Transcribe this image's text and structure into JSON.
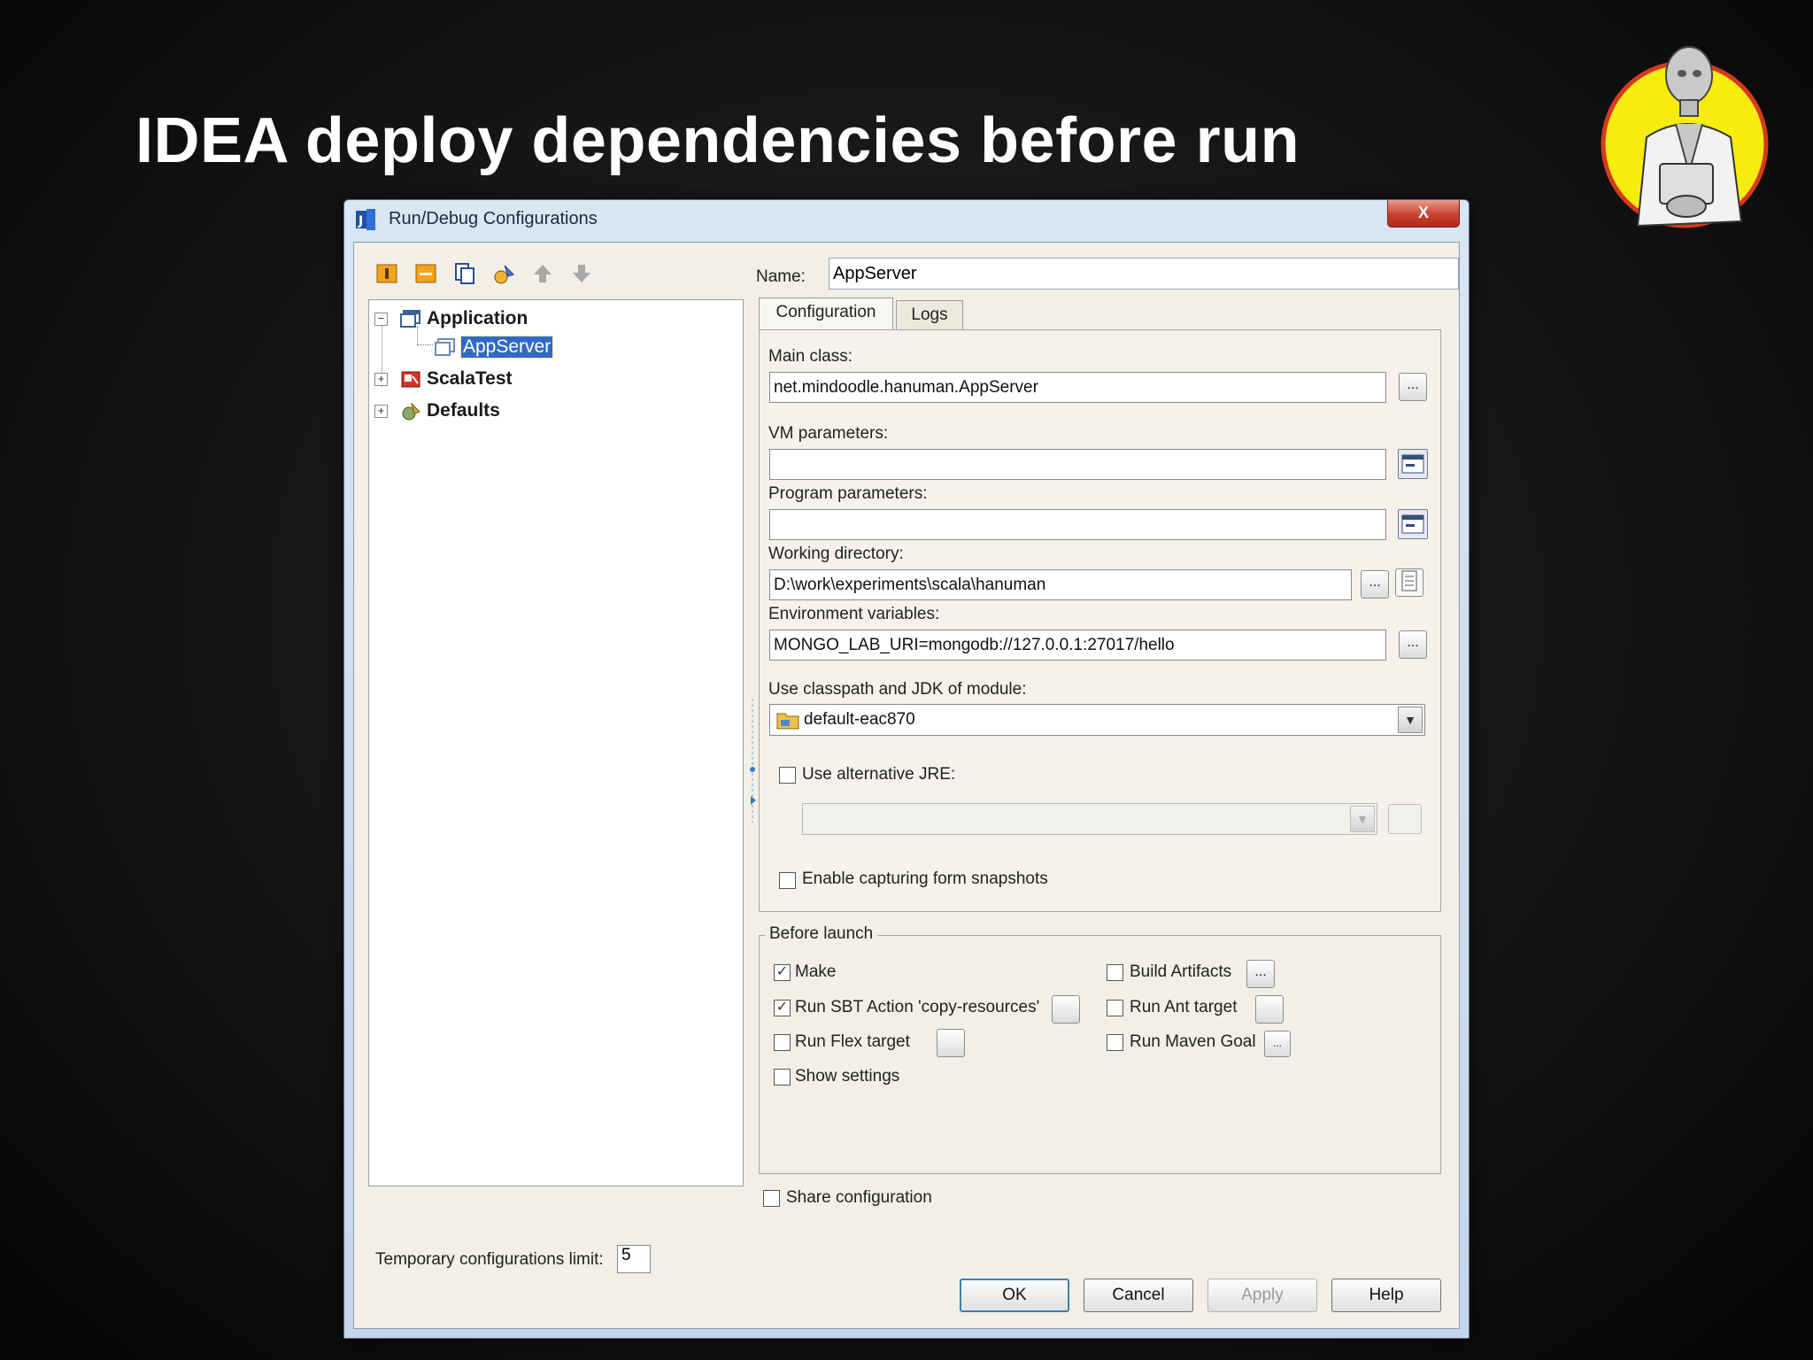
{
  "slide": {
    "title": "IDEA deploy dependencies before run"
  },
  "dialog": {
    "title": "Run/Debug Configurations",
    "close_label": "X",
    "toolbar_icons": [
      "add-icon",
      "remove-icon",
      "copy-icon",
      "edit-defaults-icon",
      "move-up-icon",
      "move-down-icon"
    ],
    "tree": {
      "items": [
        {
          "label": "Application",
          "expander": "−",
          "icon": "application-icon"
        },
        {
          "label": "AppServer",
          "icon": "app-config-icon",
          "selected": true
        },
        {
          "label": "ScalaTest",
          "expander": "+",
          "icon": "scalatest-icon"
        },
        {
          "label": "Defaults",
          "expander": "+",
          "icon": "defaults-icon"
        }
      ]
    },
    "temp_limit": {
      "label": "Temporary configurations limit:",
      "value": "5"
    },
    "name": {
      "label": "Name:",
      "value": "AppServer"
    },
    "tabs": [
      {
        "label": "Configuration",
        "active": true
      },
      {
        "label": "Logs",
        "active": false
      }
    ],
    "fields": {
      "main_class": {
        "label": "Main class:",
        "value": "net.mindoodle.hanuman.AppServer",
        "button": "..."
      },
      "vm_params": {
        "label": "VM parameters:",
        "value": ""
      },
      "program_params": {
        "label": "Program parameters:",
        "value": ""
      },
      "working_dir": {
        "label": "Working directory:",
        "value": "D:\\work\\experiments\\scala\\hanuman",
        "button": "..."
      },
      "env_vars": {
        "label": "Environment variables:",
        "value": "MONGO_LAB_URI=mongodb://127.0.0.1:27017/hello",
        "button": "..."
      },
      "classpath": {
        "label": "Use classpath and JDK of module:",
        "value": "default-eac870"
      },
      "alt_jre": {
        "label": "Use alternative JRE:",
        "checked": false,
        "value": ""
      },
      "snapshots": {
        "label": "Enable capturing form snapshots",
        "checked": false
      }
    },
    "before_launch": {
      "legend": "Before launch",
      "items": [
        {
          "label": "Make",
          "checked": true
        },
        {
          "label": "Run SBT Action 'copy-resources'",
          "checked": true
        },
        {
          "label": "Run Flex target",
          "checked": false
        },
        {
          "label": "Show settings",
          "checked": false
        },
        {
          "label": "Build Artifacts",
          "checked": false
        },
        {
          "label": "Run Ant target",
          "checked": false
        },
        {
          "label": "Run Maven Goal",
          "checked": false
        }
      ],
      "ellipsis": "...",
      "mini": "..."
    },
    "share": {
      "label": "Share configuration",
      "checked": false
    },
    "buttons": {
      "ok": "OK",
      "cancel": "Cancel",
      "apply": "Apply",
      "help": "Help"
    },
    "colors": {
      "selection": "#3169c6",
      "title_bar": "#c4d6ea",
      "close_button": "#c94231"
    }
  }
}
